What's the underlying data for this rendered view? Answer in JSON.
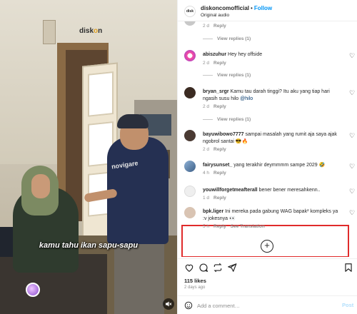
{
  "video": {
    "watermark_prefix": "disk",
    "watermark_o": "o",
    "watermark_suffix": "n",
    "subtitle": "kamu tahu ikan sapu-sapu",
    "shirt_text": "novigare"
  },
  "header": {
    "username": "diskoncomofficial",
    "separator": "•",
    "follow_label": "Follow",
    "audio_label": "Original audio",
    "avatar_text": "disk"
  },
  "comments": [
    {
      "user": "",
      "text": "",
      "age": "2 d",
      "reply": "Reply",
      "view_replies": "View replies (1)"
    },
    {
      "user": "abiszuhur",
      "text": "Hey hey offside",
      "age": "2 d",
      "reply": "Reply",
      "view_replies": "View replies (1)"
    },
    {
      "user": "bryan_srgr",
      "text": "Kamu tau darah tinggi? Itu aku yang tiap hari ngasih susu hilo",
      "mention": "@hilo",
      "age": "2 d",
      "reply": "Reply",
      "view_replies": "View replies (1)"
    },
    {
      "user": "bayuwibowo7777",
      "text": "sampai masalah yang rumit aja saya ajak ngobrol santai 😎🔥",
      "age": "2 d",
      "reply": "Reply"
    },
    {
      "user": "fairysunset_",
      "text": "yang terakhir deymmmm sampe 2029 🤣",
      "age": "4 h",
      "reply": "Reply"
    },
    {
      "user": "youwillforgetmeafterall",
      "text": "bener bener meresahkenn..",
      "age": "1 d",
      "reply": "Reply"
    },
    {
      "user": "bpk.liger",
      "text": "Ini mereka pada gabung WAG bapak² kompleks ya :v jokesnya 👀",
      "age": "5 h",
      "reply": "Reply",
      "see_translation": "See Translation"
    }
  ],
  "footer": {
    "likes": "115 likes",
    "ago": "2 days ago",
    "placeholder": "Add a comment…",
    "post_label": "Post"
  },
  "colors": {
    "accent": "#0095f6",
    "highlight": "#e02b2b",
    "muted": "#8e8e8e"
  }
}
